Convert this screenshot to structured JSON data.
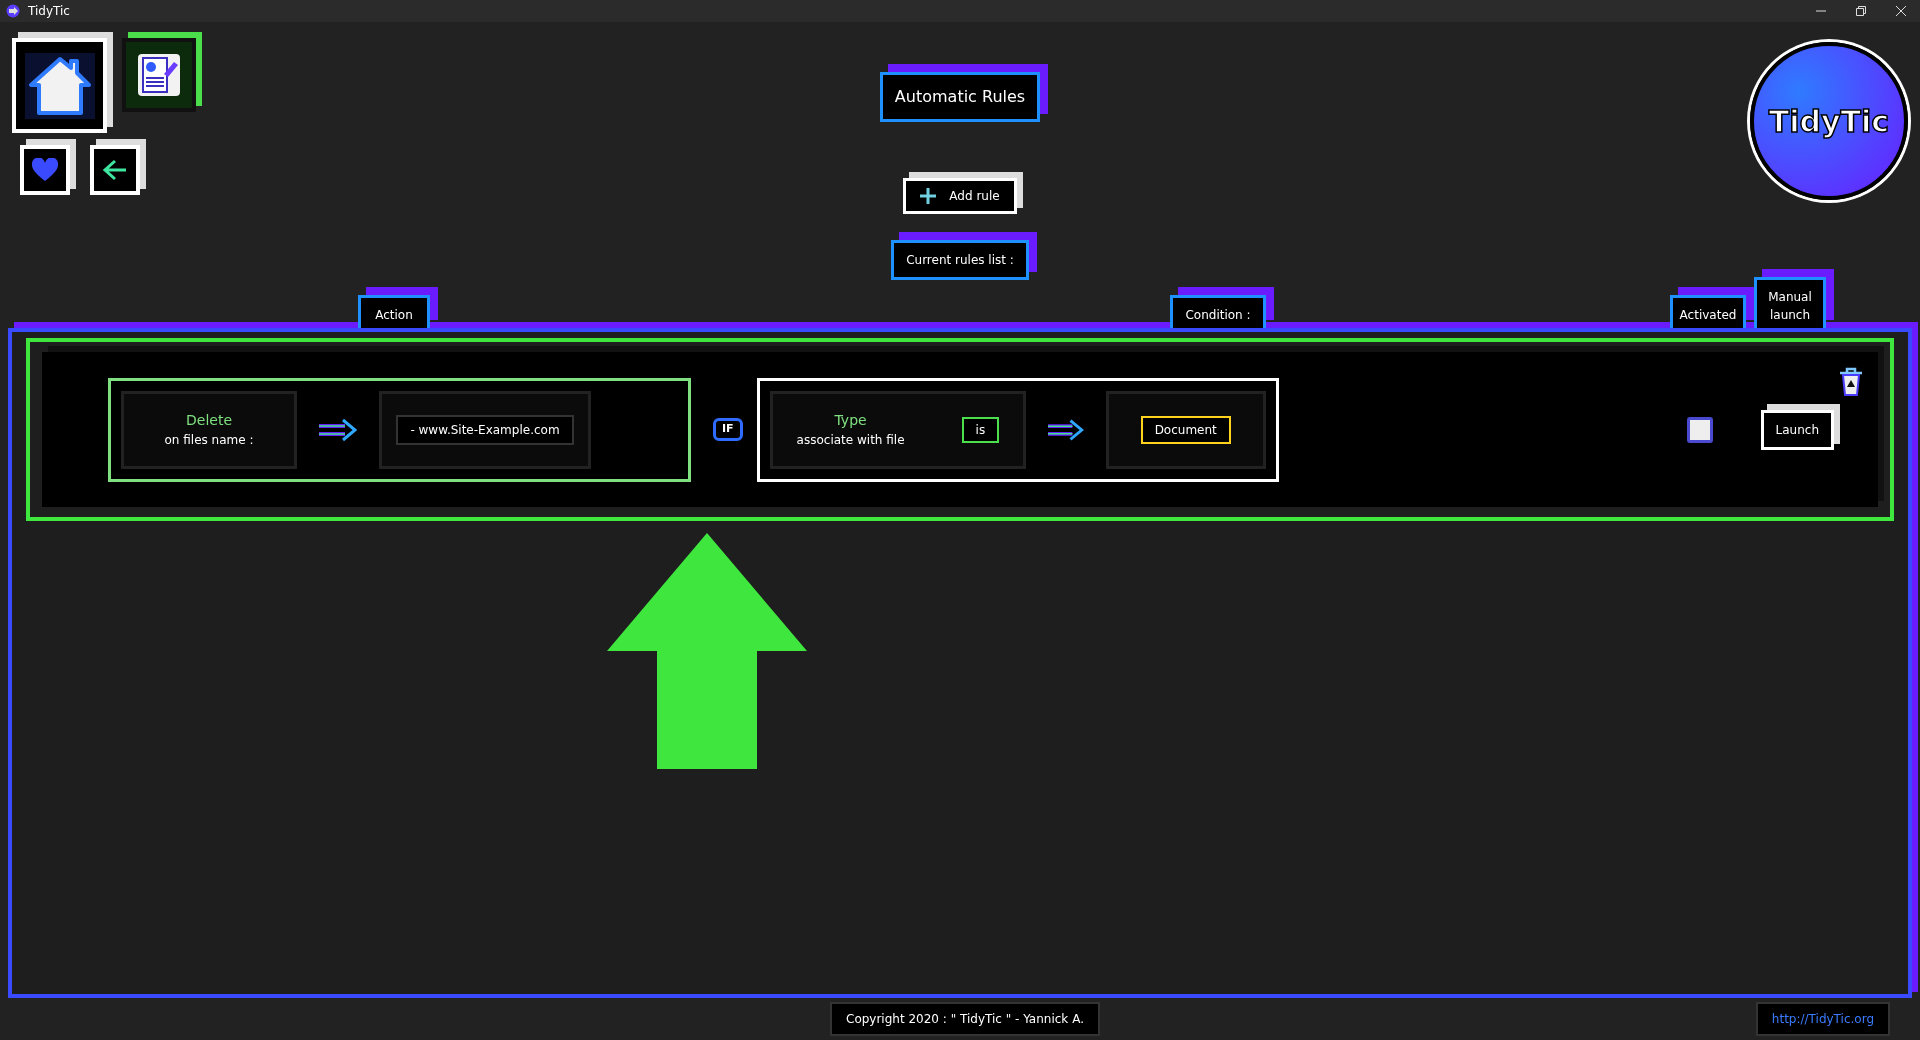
{
  "window": {
    "title": "TidyTic"
  },
  "header": {
    "title": "Automatic Rules",
    "add_button": "Add rule",
    "list_label": "Current rules list :"
  },
  "logo": {
    "text": "TidyTic"
  },
  "columns": [
    {
      "label": "Action"
    },
    {
      "label": "Condition :"
    },
    {
      "label": "Activated"
    },
    {
      "label": "Manual launch"
    }
  ],
  "rules": [
    {
      "selected": true,
      "action": "Delete",
      "action_detail": "on files name :",
      "target": "- www.Site-Example.com",
      "connector": "IF",
      "condition": "Type",
      "condition_detail": "associate with file",
      "operator": "is",
      "value": "Document",
      "activated": false,
      "launch_button": "Launch"
    }
  ],
  "footer": {
    "copyright": "Copyright 2020 : \" TidyTic \" - Yannick A.",
    "link": "http://TidyTic.org"
  }
}
